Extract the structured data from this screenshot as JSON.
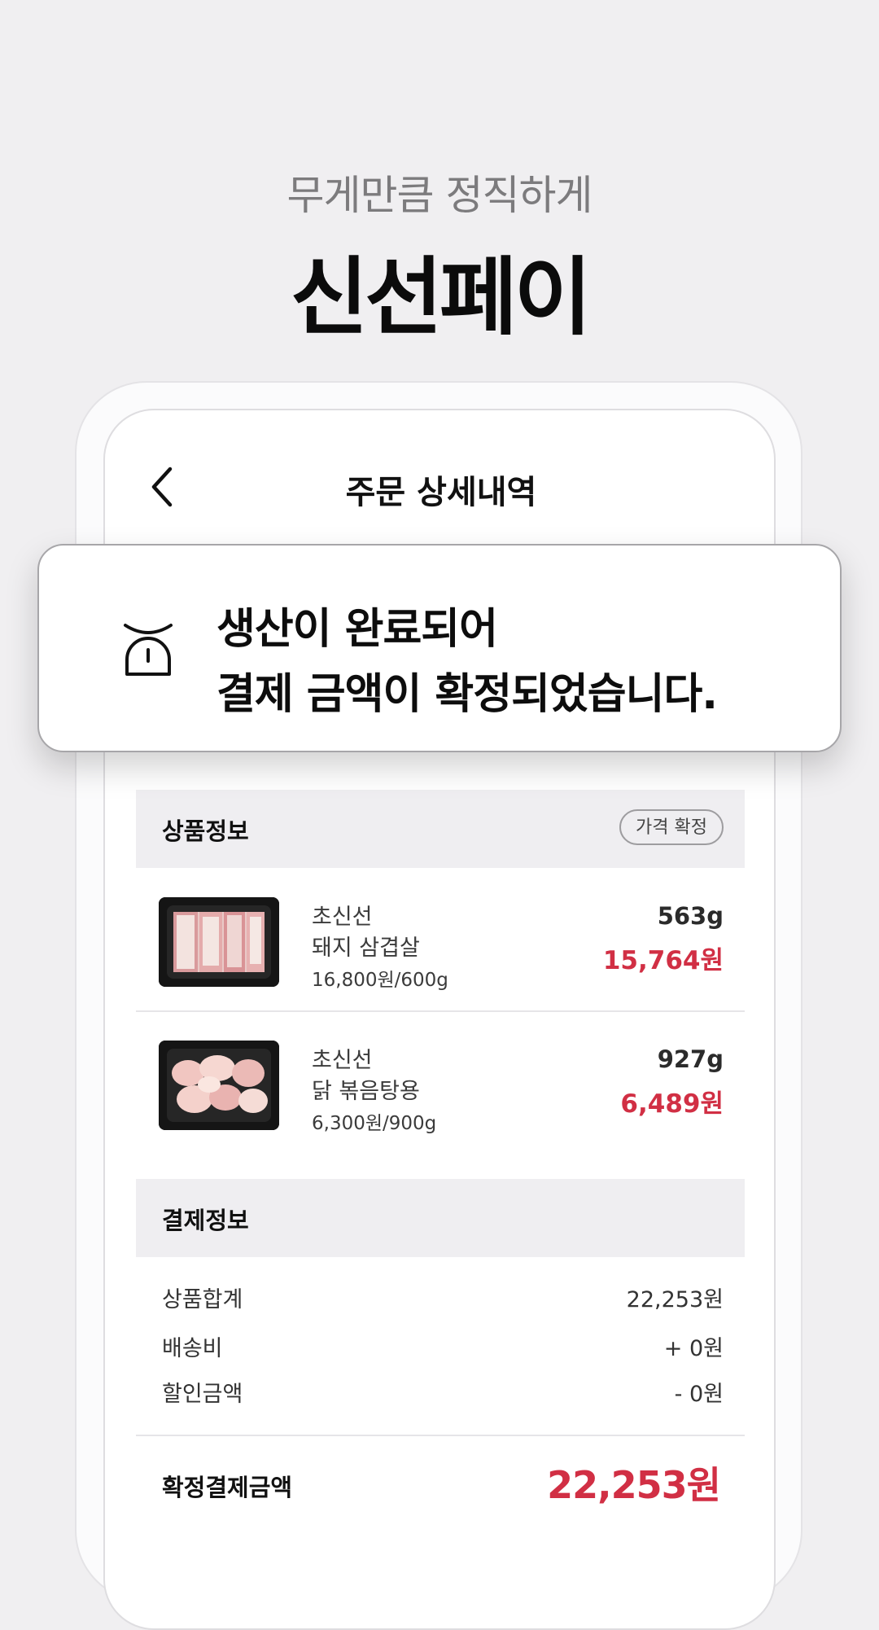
{
  "header": {
    "tagline": "무게만큼 정직하게",
    "brand": "신선페이"
  },
  "screen": {
    "nav_title": "주문 상세내역",
    "product_section": {
      "label": "상품정보",
      "badge": "가격 확정"
    },
    "products": [
      {
        "brand": "초신선",
        "name": "돼지 삼겹살",
        "unit_price": "16,800원/600g",
        "weight": "563g",
        "price": "15,764원"
      },
      {
        "brand": "초신선",
        "name": "닭 볶음탕용",
        "unit_price": "6,300원/900g",
        "weight": "927g",
        "price": "6,489원"
      }
    ],
    "payment_section": {
      "label": "결제정보"
    },
    "payment_rows": [
      {
        "label": "상품합계",
        "value": "22,253원"
      },
      {
        "label": "배송비",
        "value": "+ 0원"
      },
      {
        "label": "할인금액",
        "value": "- 0원"
      }
    ],
    "total": {
      "label": "확정결제금액",
      "value": "22,253원"
    }
  },
  "notice": {
    "icon": "scale-icon",
    "line1": "생산이 완료되어",
    "line2": "결제 금액이 확정되었습니다."
  },
  "colors": {
    "accent_red": "#d12f44",
    "background": "#f0eff1"
  }
}
